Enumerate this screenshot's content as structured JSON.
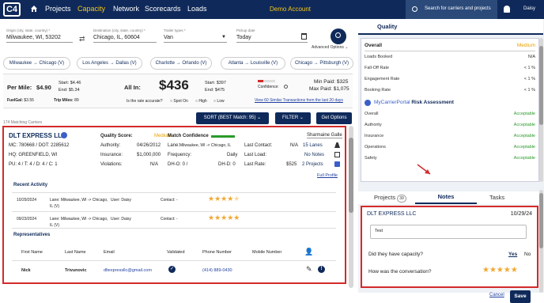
{
  "app": {
    "logo": "C4",
    "nav": [
      "Projects",
      "Capacity",
      "Network",
      "Scorecards",
      "Loads"
    ],
    "active_nav": "Capacity",
    "demo_label": "Demo Account",
    "search_placeholder": "Search for carriers and projects",
    "user": "Daisy"
  },
  "search_form": {
    "origin_label": "Origin (city, state, country) *",
    "origin_value": "Milwaukee, WI, 53202",
    "destination_label": "Destination (city, state, country) *",
    "destination_value": "Chicago, IL, 60604",
    "trailer_label": "Trailer types *",
    "trailer_value": "Van",
    "pickup_label": "Pickup date",
    "pickup_value": "Today",
    "advanced_options": "Advanced Options"
  },
  "lanes": [
    {
      "from": "Milwaukee",
      "to": "Chicago (V)"
    },
    {
      "from": "Los Angeles",
      "to": "Dallas (V)"
    },
    {
      "from": "Charlotte",
      "to": "Orlando (V)"
    },
    {
      "from": "Atlanta",
      "to": "Louisville (V)"
    },
    {
      "from": "Chicago",
      "to": "Pittsburgh (V)"
    }
  ],
  "rates": {
    "per_mile_label": "Per Mile:",
    "per_mile": "$4.90",
    "start_label": "Start:",
    "start_pm": "$4.46",
    "end_label": "End:",
    "end_pm": "$5.34",
    "fuel_label": "FuelGal:",
    "fuel": "$3.55",
    "trip_miles_label": "Trip Miles:",
    "trip_miles": "89",
    "all_in_label": "All In:",
    "all_in": "$436",
    "start_all": "$397",
    "end_all": "$475",
    "confidence_label": "Confidence:",
    "accurate_q": "Is the rate accurate?",
    "options": [
      "Spot On",
      "High",
      "Low"
    ],
    "min_paid": "Min Paid: $325",
    "max_paid": "Max Paid: $1,075",
    "similar_link": "View 60 Similar Transactions from the last 20 days"
  },
  "list": {
    "count": "174 Matching Carriers",
    "sort_button": "SORT (BEST Match: 95)",
    "filter_button": "FILTER",
    "options_button": "Get Options"
  },
  "carrier": {
    "name": "DLT EXPRESS LLC",
    "mc_dot": "MC: 780668 / DOT: 2285612",
    "hq": "HQ: GREENFIELD, WI",
    "pu": "PU: 4 / T: 4 / D: 4 / C: 1",
    "quality_label": "Quality Score:",
    "quality": "Medium",
    "authority_label": "Authority:",
    "authority": "04/26/2012",
    "insurance_label": "Insurance:",
    "insurance": "$1,000,000",
    "violations_label": "Violations:",
    "violations": "N/A",
    "match_label": "Match Confidence",
    "lane_label": "Lane:",
    "lane": "Milwaukee, WI -> Chicago, IL",
    "frequency_label": "Frequency:",
    "frequency": "Daily",
    "dho_label": "DH-O: 0 /",
    "dhd_label": "DH-D: 0",
    "last_contact_label": "Last Contact:",
    "last_contact": "N/A",
    "last_load_label": "Last Load:",
    "last_rate_label": "Last Rate:",
    "last_rate": "$525",
    "owner": "Sharmaine Galle",
    "lanes_count": "15 Lanes",
    "notes": "No Notes",
    "projects": "2 Projects",
    "full_profile": "Full Profile",
    "recent_activity_title": "Recent Activity",
    "activities": [
      {
        "date": "10/29/2024",
        "lane": "Lane: Milwaukee, WI -> Chicago,",
        "user": "User: Daisy",
        "lane2": "IL (V)",
        "contact": "Contact: -"
      },
      {
        "date": "09/23/2024",
        "lane": "Lane: Milwaukee, WI -> Chicago,",
        "user": "User: Daisy",
        "lane2": "IL (V)",
        "contact": "Contact: -"
      }
    ],
    "reps_title": "Representatives",
    "rep_headers": [
      "First Name",
      "Last Name",
      "Email",
      "Validated",
      "Phone Number",
      "Mobile Number"
    ],
    "rep": {
      "first": "Nick",
      "last": "Trivunovic",
      "email": "dltexpressllc@gmail.com",
      "phone": "(414) 889-0430",
      "mobile": ""
    }
  },
  "quality_panel": {
    "tab": "Quality",
    "overall_label": "Overall",
    "overall_value": "Medium",
    "rows": [
      {
        "label": "Loads Booked",
        "value": "N/A"
      },
      {
        "label": "Fall-Off Rate",
        "value": "< 1 %"
      },
      {
        "label": "Engagement Rate",
        "value": "< 1 %"
      },
      {
        "label": "Booking Rate",
        "value": "< 1 %"
      }
    ],
    "mcp_title": "MyCarrierPortal",
    "mcp_suffix": "Risk Assessment",
    "mcp_rows": [
      {
        "label": "Overall",
        "value": "Acceptable"
      },
      {
        "label": "Authority",
        "value": "Acceptable"
      },
      {
        "label": "Insurance",
        "value": "Acceptable"
      },
      {
        "label": "Operations",
        "value": "Acceptable"
      },
      {
        "label": "Safety",
        "value": "Acceptable"
      }
    ]
  },
  "notes_panel": {
    "tab_projects": "Projects",
    "projects_count": "39",
    "tab_notes": "Notes",
    "tab_tasks": "Tasks",
    "carrier": "DLT EXPRESS LLC",
    "date": "10/29/24",
    "note_text": "Test",
    "capacity_q": "Did they have capacity?",
    "yes": "Yes",
    "no": "No",
    "conversation_q": "How was the conversation?",
    "cancel": "Cancel",
    "save": "Save"
  },
  "colors": {
    "navy": "#0f2a5a",
    "gold": "#f5c518",
    "red": "#d32a2a",
    "green": "#2a9a2a",
    "star": "#f0a830"
  }
}
